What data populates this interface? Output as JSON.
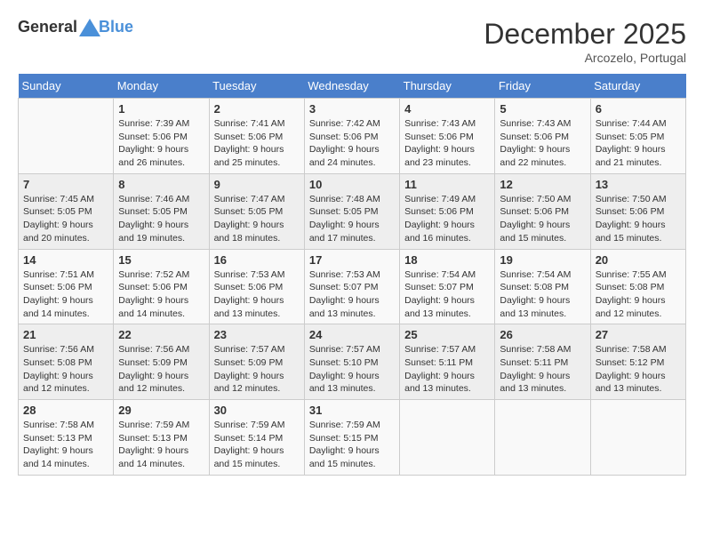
{
  "header": {
    "logo_general": "General",
    "logo_blue": "Blue",
    "month_year": "December 2025",
    "location": "Arcozelo, Portugal"
  },
  "weekdays": [
    "Sunday",
    "Monday",
    "Tuesday",
    "Wednesday",
    "Thursday",
    "Friday",
    "Saturday"
  ],
  "weeks": [
    [
      {
        "day": "",
        "info": ""
      },
      {
        "day": "1",
        "info": "Sunrise: 7:39 AM\nSunset: 5:06 PM\nDaylight: 9 hours\nand 26 minutes."
      },
      {
        "day": "2",
        "info": "Sunrise: 7:41 AM\nSunset: 5:06 PM\nDaylight: 9 hours\nand 25 minutes."
      },
      {
        "day": "3",
        "info": "Sunrise: 7:42 AM\nSunset: 5:06 PM\nDaylight: 9 hours\nand 24 minutes."
      },
      {
        "day": "4",
        "info": "Sunrise: 7:43 AM\nSunset: 5:06 PM\nDaylight: 9 hours\nand 23 minutes."
      },
      {
        "day": "5",
        "info": "Sunrise: 7:43 AM\nSunset: 5:06 PM\nDaylight: 9 hours\nand 22 minutes."
      },
      {
        "day": "6",
        "info": "Sunrise: 7:44 AM\nSunset: 5:05 PM\nDaylight: 9 hours\nand 21 minutes."
      }
    ],
    [
      {
        "day": "7",
        "info": "Sunrise: 7:45 AM\nSunset: 5:05 PM\nDaylight: 9 hours\nand 20 minutes."
      },
      {
        "day": "8",
        "info": "Sunrise: 7:46 AM\nSunset: 5:05 PM\nDaylight: 9 hours\nand 19 minutes."
      },
      {
        "day": "9",
        "info": "Sunrise: 7:47 AM\nSunset: 5:05 PM\nDaylight: 9 hours\nand 18 minutes."
      },
      {
        "day": "10",
        "info": "Sunrise: 7:48 AM\nSunset: 5:05 PM\nDaylight: 9 hours\nand 17 minutes."
      },
      {
        "day": "11",
        "info": "Sunrise: 7:49 AM\nSunset: 5:06 PM\nDaylight: 9 hours\nand 16 minutes."
      },
      {
        "day": "12",
        "info": "Sunrise: 7:50 AM\nSunset: 5:06 PM\nDaylight: 9 hours\nand 15 minutes."
      },
      {
        "day": "13",
        "info": "Sunrise: 7:50 AM\nSunset: 5:06 PM\nDaylight: 9 hours\nand 15 minutes."
      }
    ],
    [
      {
        "day": "14",
        "info": "Sunrise: 7:51 AM\nSunset: 5:06 PM\nDaylight: 9 hours\nand 14 minutes."
      },
      {
        "day": "15",
        "info": "Sunrise: 7:52 AM\nSunset: 5:06 PM\nDaylight: 9 hours\nand 14 minutes."
      },
      {
        "day": "16",
        "info": "Sunrise: 7:53 AM\nSunset: 5:06 PM\nDaylight: 9 hours\nand 13 minutes."
      },
      {
        "day": "17",
        "info": "Sunrise: 7:53 AM\nSunset: 5:07 PM\nDaylight: 9 hours\nand 13 minutes."
      },
      {
        "day": "18",
        "info": "Sunrise: 7:54 AM\nSunset: 5:07 PM\nDaylight: 9 hours\nand 13 minutes."
      },
      {
        "day": "19",
        "info": "Sunrise: 7:54 AM\nSunset: 5:08 PM\nDaylight: 9 hours\nand 13 minutes."
      },
      {
        "day": "20",
        "info": "Sunrise: 7:55 AM\nSunset: 5:08 PM\nDaylight: 9 hours\nand 12 minutes."
      }
    ],
    [
      {
        "day": "21",
        "info": "Sunrise: 7:56 AM\nSunset: 5:08 PM\nDaylight: 9 hours\nand 12 minutes."
      },
      {
        "day": "22",
        "info": "Sunrise: 7:56 AM\nSunset: 5:09 PM\nDaylight: 9 hours\nand 12 minutes."
      },
      {
        "day": "23",
        "info": "Sunrise: 7:57 AM\nSunset: 5:09 PM\nDaylight: 9 hours\nand 12 minutes."
      },
      {
        "day": "24",
        "info": "Sunrise: 7:57 AM\nSunset: 5:10 PM\nDaylight: 9 hours\nand 13 minutes."
      },
      {
        "day": "25",
        "info": "Sunrise: 7:57 AM\nSunset: 5:11 PM\nDaylight: 9 hours\nand 13 minutes."
      },
      {
        "day": "26",
        "info": "Sunrise: 7:58 AM\nSunset: 5:11 PM\nDaylight: 9 hours\nand 13 minutes."
      },
      {
        "day": "27",
        "info": "Sunrise: 7:58 AM\nSunset: 5:12 PM\nDaylight: 9 hours\nand 13 minutes."
      }
    ],
    [
      {
        "day": "28",
        "info": "Sunrise: 7:58 AM\nSunset: 5:13 PM\nDaylight: 9 hours\nand 14 minutes."
      },
      {
        "day": "29",
        "info": "Sunrise: 7:59 AM\nSunset: 5:13 PM\nDaylight: 9 hours\nand 14 minutes."
      },
      {
        "day": "30",
        "info": "Sunrise: 7:59 AM\nSunset: 5:14 PM\nDaylight: 9 hours\nand 15 minutes."
      },
      {
        "day": "31",
        "info": "Sunrise: 7:59 AM\nSunset: 5:15 PM\nDaylight: 9 hours\nand 15 minutes."
      },
      {
        "day": "",
        "info": ""
      },
      {
        "day": "",
        "info": ""
      },
      {
        "day": "",
        "info": ""
      }
    ]
  ]
}
